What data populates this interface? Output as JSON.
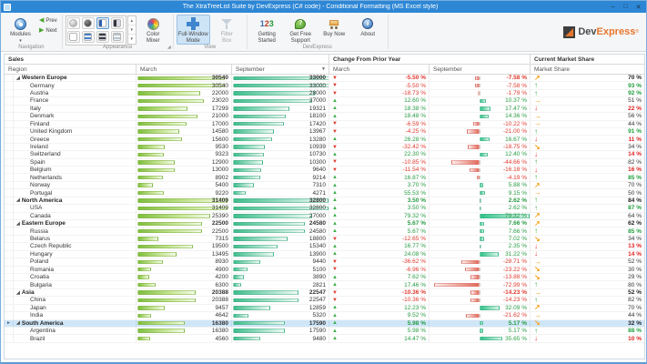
{
  "window": {
    "title": "The XtraTreeList Suite by DevExpress (C# code) - Conditional Formatting  (MS Excel style)",
    "min": "–",
    "max": "□",
    "close": "✕"
  },
  "ribbon": {
    "groups": {
      "navigation": "Navigation",
      "appearance": "Appearance",
      "view": "View",
      "devexpress": "DevExpress"
    },
    "modules": "Modules",
    "modules_caret": "▾",
    "prev": "Prev",
    "next": "Next",
    "prev_glyph": "◀",
    "next_glyph": "▶",
    "color_mixer": [
      "Color",
      "Mixer"
    ],
    "full_window": [
      "Full-Window",
      "Mode"
    ],
    "filter_box": [
      "Filter",
      "Box"
    ],
    "getting_started": [
      "Getting",
      "Started"
    ],
    "get_support": [
      "Get Free",
      "Support"
    ],
    "buy_now": "Buy Now",
    "about": "About",
    "num123": [
      "1",
      "2",
      "3"
    ],
    "gallery_up": "▴",
    "gallery_down": "▾",
    "gallery_drop": "▾",
    "launcher_glyph": "◢"
  },
  "logo": {
    "dev": "Dev",
    "express": "Express",
    "reg": "®"
  },
  "tree": {
    "bands": [
      "Sales",
      "Change From Prior Year",
      "Current Market Share"
    ],
    "columns": {
      "region": "Region",
      "march": "March",
      "september": "September",
      "ch_march": "March",
      "ch_september": "September",
      "share": "Market Share"
    },
    "sort_glyph": "▼",
    "expand_glyph": "◢",
    "focus_glyph": "►",
    "sales_max": 33000,
    "change_max": 80,
    "glyphs": {
      "up": "↑",
      "down": "↓",
      "right": "→",
      "ne": "↗",
      "se": "↘"
    },
    "rows": [
      {
        "region": "Western Europe",
        "group": true,
        "m": 30540,
        "s": 33000,
        "cm": -5.5,
        "cs": -7.58,
        "share": 70,
        "arrow": "ne",
        "ss": "bold-dark"
      },
      {
        "region": "Germany",
        "m": 30540,
        "s": 33000,
        "cm": -5.5,
        "cs": -7.58,
        "share": 93,
        "arrow": "up",
        "ss": "bold-green"
      },
      {
        "region": "Austria",
        "m": 22000,
        "s": 28000,
        "cm": -18.73,
        "cs": -1.79,
        "share": 92,
        "arrow": "up",
        "ss": "bold-green"
      },
      {
        "region": "France",
        "m": 23020,
        "s": 27000,
        "cm": 12.6,
        "cs": 10.37,
        "share": 51,
        "arrow": "right",
        "ss": "plain"
      },
      {
        "region": "Italy",
        "m": 17299,
        "s": 19321,
        "cm": 18.38,
        "cs": 17.47,
        "share": 22,
        "arrow": "down",
        "ss": "bold-red"
      },
      {
        "region": "Denmark",
        "m": 21000,
        "s": 18100,
        "cm": 18.48,
        "cs": 14.36,
        "share": 56,
        "arrow": "right",
        "ss": "plain"
      },
      {
        "region": "Finland",
        "m": 17000,
        "s": 17420,
        "cm": -6.59,
        "cs": -10.22,
        "share": 44,
        "arrow": "right",
        "ss": "plain"
      },
      {
        "region": "United Kingdom",
        "m": 14580,
        "s": 13967,
        "cm": -4.25,
        "cs": -21.0,
        "share": 91,
        "arrow": "up",
        "ss": "bold-green"
      },
      {
        "region": "Greece",
        "m": 15600,
        "s": 13280,
        "cm": 26.28,
        "cs": 16.67,
        "share": 11,
        "arrow": "down",
        "ss": "bold-red"
      },
      {
        "region": "Ireland",
        "m": 9530,
        "s": 10939,
        "cm": -32.42,
        "cs": -18.75,
        "share": 34,
        "arrow": "se",
        "ss": "plain"
      },
      {
        "region": "Switzerland",
        "m": 9323,
        "s": 10730,
        "cm": 22.3,
        "cs": 12.4,
        "share": 14,
        "arrow": "down",
        "ss": "bold-red"
      },
      {
        "region": "Spain",
        "m": 12900,
        "s": 10300,
        "cm": -10.85,
        "cs": -44.66,
        "share": 82,
        "arrow": "up",
        "ss": "plain"
      },
      {
        "region": "Belgium",
        "m": 13000,
        "s": 9640,
        "cm": -11.54,
        "cs": -16.18,
        "share": 16,
        "arrow": "down",
        "ss": "bold-red"
      },
      {
        "region": "Netherlands",
        "m": 8902,
        "s": 9214,
        "cm": 16.87,
        "cs": -4.19,
        "share": 85,
        "arrow": "up",
        "ss": "bold-green"
      },
      {
        "region": "Norway",
        "m": 5400,
        "s": 7310,
        "cm": 3.7,
        "cs": 5.88,
        "share": 70,
        "arrow": "ne",
        "ss": "plain"
      },
      {
        "region": "Portugal",
        "m": 9220,
        "s": 4271,
        "cm": 55.53,
        "cs": 9.15,
        "share": 50,
        "arrow": "right",
        "ss": "plain"
      },
      {
        "region": "North America",
        "group": true,
        "m": 31400,
        "s": 32800,
        "cm": 3.5,
        "cs": 2.62,
        "share": 84,
        "arrow": "up",
        "ss": "bold-dark"
      },
      {
        "region": "USA",
        "m": 31400,
        "s": 32800,
        "cm": 3.5,
        "cs": 2.62,
        "share": 87,
        "arrow": "up",
        "ss": "bold-green"
      },
      {
        "region": "Canada",
        "m": 25390,
        "s": 27000,
        "cm": 79.32,
        "cs": 79.32,
        "share": 64,
        "arrow": "ne",
        "ss": "plain"
      },
      {
        "region": "Eastern Europe",
        "group": true,
        "m": 22500,
        "s": 24580,
        "cm": 5.67,
        "cs": 7.66,
        "share": 62,
        "arrow": "ne",
        "ss": "bold-dark"
      },
      {
        "region": "Russia",
        "m": 22500,
        "s": 24580,
        "cm": 5.67,
        "cs": 7.66,
        "share": 85,
        "arrow": "up",
        "ss": "bold-green"
      },
      {
        "region": "Belarus",
        "m": 7315,
        "s": 18800,
        "cm": -12.65,
        "cs": 7.02,
        "share": 34,
        "arrow": "se",
        "ss": "plain"
      },
      {
        "region": "Czech Republic",
        "m": 19500,
        "s": 15340,
        "cm": 16.77,
        "cs": 2.35,
        "share": 13,
        "arrow": "down",
        "ss": "bold-red"
      },
      {
        "region": "Hungary",
        "m": 13495,
        "s": 13900,
        "cm": 24.08,
        "cs": 31.22,
        "share": 14,
        "arrow": "down",
        "ss": "bold-red"
      },
      {
        "region": "Poland",
        "m": 8930,
        "s": 9440,
        "cm": -36.62,
        "cs": -28.71,
        "share": 52,
        "arrow": "right",
        "ss": "plain"
      },
      {
        "region": "Romania",
        "m": 4900,
        "s": 5100,
        "cm": -6.96,
        "cs": -23.22,
        "share": 30,
        "arrow": "se",
        "ss": "plain"
      },
      {
        "region": "Croatia",
        "m": 4200,
        "s": 3890,
        "cm": 7.62,
        "cs": -13.88,
        "share": 29,
        "arrow": "se",
        "ss": "plain"
      },
      {
        "region": "Bulgaria",
        "m": 6300,
        "s": 2821,
        "cm": 17.46,
        "cs": -72.99,
        "share": 80,
        "arrow": "up",
        "ss": "plain"
      },
      {
        "region": "Asia",
        "group": true,
        "m": 20388,
        "s": 22547,
        "cm": -10.36,
        "cs": -14.23,
        "share": 52,
        "arrow": "right",
        "ss": "bold-dark"
      },
      {
        "region": "China",
        "m": 20388,
        "s": 22547,
        "cm": -10.36,
        "cs": -14.23,
        "share": 82,
        "arrow": "up",
        "ss": "plain"
      },
      {
        "region": "Japan",
        "m": 9457,
        "s": 12859,
        "cm": 12.23,
        "cs": 32.09,
        "share": 70,
        "arrow": "ne",
        "ss": "plain"
      },
      {
        "region": "India",
        "m": 4642,
        "s": 5320,
        "cm": 9.52,
        "cs": -21.62,
        "share": 44,
        "arrow": "right",
        "ss": "plain"
      },
      {
        "region": "South America",
        "group": true,
        "selected": true,
        "m": 16380,
        "s": 17590,
        "cm": 5.98,
        "cs": 5.17,
        "share": 32,
        "arrow": "se",
        "ss": "bold-dark"
      },
      {
        "region": "Argentina",
        "m": 16380,
        "s": 17590,
        "cm": 5.98,
        "cs": 5.17,
        "share": 88,
        "arrow": "up",
        "ss": "bold-green"
      },
      {
        "region": "Brazil",
        "m": 4560,
        "s": 9480,
        "cm": 14.47,
        "cs": 35.65,
        "share": 10,
        "arrow": "down",
        "ss": "bold-red"
      }
    ]
  }
}
